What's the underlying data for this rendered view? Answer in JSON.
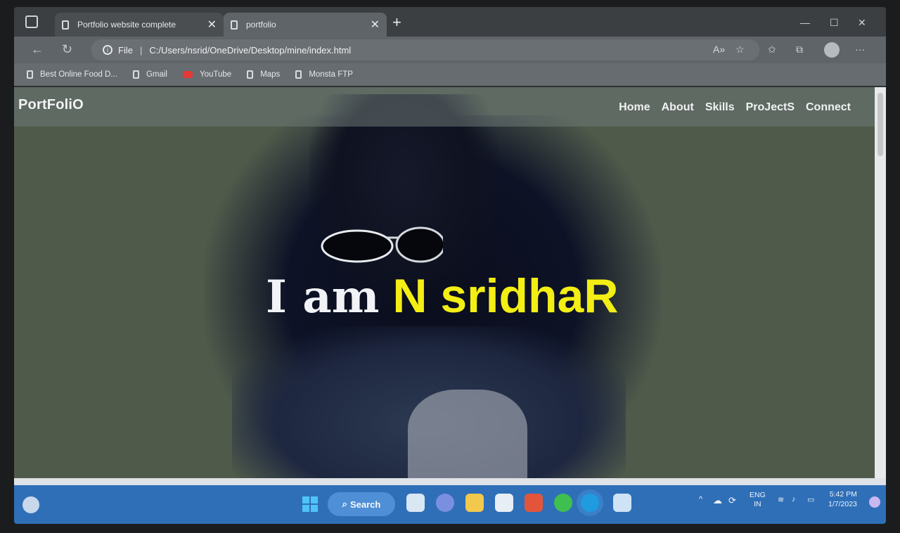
{
  "browser": {
    "tabs": [
      {
        "title": "Portfolio website complete",
        "active": false
      },
      {
        "title": "portfolio",
        "active": true
      }
    ],
    "address_prefix": "File",
    "url": "C:/Users/nsrid/OneDrive/Desktop/mine/index.html",
    "bookmarks": [
      {
        "label": "Best Online Food D...",
        "icon": "page-icon"
      },
      {
        "label": "Gmail",
        "icon": "page-icon"
      },
      {
        "label": "YouTube",
        "icon": "youtube-icon"
      },
      {
        "label": "Maps",
        "icon": "page-icon"
      },
      {
        "label": "Monsta FTP",
        "icon": "page-icon"
      }
    ]
  },
  "site": {
    "logo": "PortFoliO",
    "nav": [
      "Home",
      "About",
      "Skills",
      "ProJectS",
      "Connect"
    ],
    "hero_lead": "I am",
    "hero_name": "N sridhaR",
    "colors": {
      "name": "#f3ee14",
      "lead": "#f2f3f6"
    }
  },
  "taskbar": {
    "search_label": "Search",
    "lang_line1": "ENG",
    "lang_line2": "IN",
    "time": "5:42 PM",
    "date": "1/7/2023"
  }
}
